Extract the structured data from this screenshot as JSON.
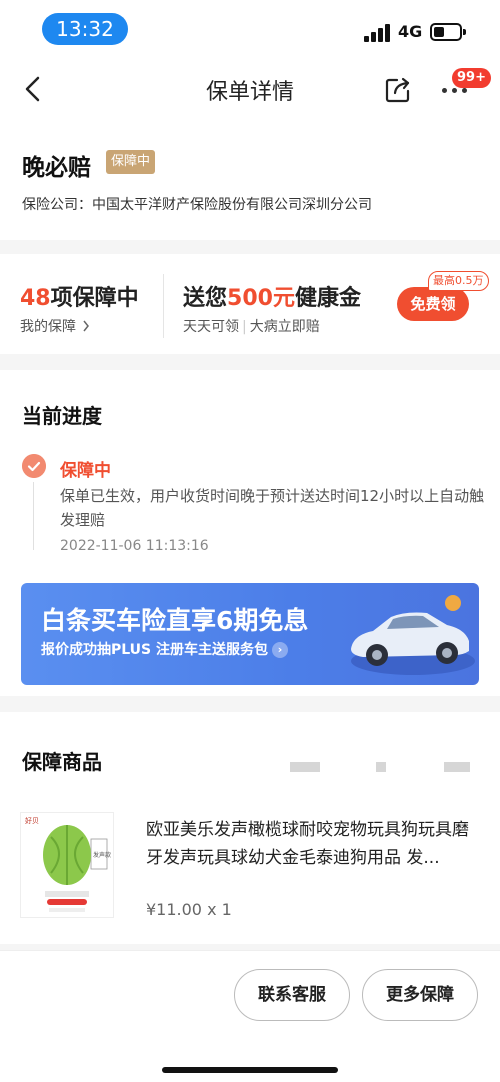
{
  "status_bar": {
    "time": "13:32",
    "network": "4G"
  },
  "nav": {
    "title": "保单详情",
    "badge": "99+"
  },
  "policy": {
    "name": "晚必赔",
    "status": "保障中",
    "company": "保险公司：中国太平洋财产保险股份有限公司深圳分公司"
  },
  "coverage": {
    "count": "48",
    "count_suffix": "项保障中",
    "my_label": "我的保障",
    "gift_prefix": "送您",
    "gift_amount": "500元",
    "gift_suffix": "健康金",
    "gift_sub1": "天天可领",
    "gift_sub2": "大病立即赔",
    "free_label": "免费领",
    "max_tag": "最高0.5万"
  },
  "progress": {
    "title": "当前进度",
    "status": "保障中",
    "desc": "保单已生效，用户收货时间晚于预计送达时间12小时以上自动触发理赔",
    "time": "2022-11-06 11:13:16"
  },
  "banner": {
    "title": "白条买车险直享6期免息",
    "subtitle": "报价成功抽PLUS 注册车主送服务包"
  },
  "goods": {
    "title": "保障商品",
    "product_name": "欧亚美乐发声橄榄球耐咬宠物玩具狗玩具磨牙发声玩具球幼犬金毛泰迪狗用品 发...",
    "price": "¥11.00 x 1",
    "img_text_top": "好贝",
    "img_text_mid": "发声款"
  },
  "footer": {
    "service_label": "联系客服",
    "more_label": "更多保障"
  },
  "colors": {
    "accent": "#f04e30",
    "badge_gold": "#c9a574",
    "banner_blue": "#4c7ee8"
  }
}
